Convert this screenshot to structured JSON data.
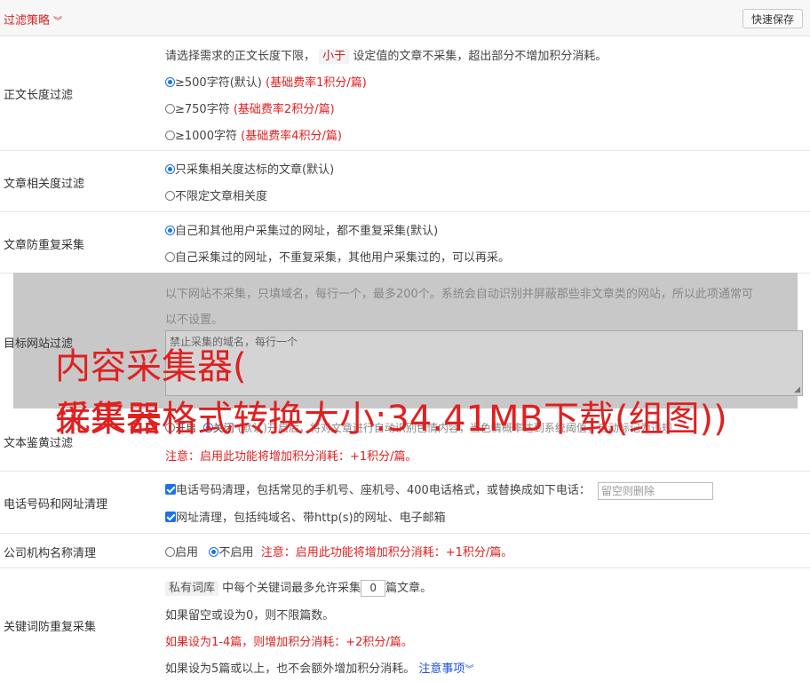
{
  "header": {
    "title": "过滤策略",
    "save_label": "快速保存"
  },
  "length_filter": {
    "label": "正文长度过滤",
    "desc_before": "请选择需求的正文长度下限，",
    "desc_pill": "小于",
    "desc_after": "设定值的文章不采集，超出部分不增加积分消耗。",
    "options": [
      {
        "text": "≥500字符(默认)",
        "note": "(基础费率1积分/篇)",
        "selected": true
      },
      {
        "text": "≥750字符",
        "note": "(基础费率2积分/篇)",
        "selected": false
      },
      {
        "text": "≥1000字符",
        "note": "(基础费率4积分/篇)",
        "selected": false
      }
    ]
  },
  "relevance_filter": {
    "label": "文章相关度过滤",
    "options": [
      {
        "text": "只采集相关度达标的文章(默认)",
        "selected": true
      },
      {
        "text": "不限定文章相关度",
        "selected": false
      }
    ]
  },
  "dedupe": {
    "label": "文章防重复采集",
    "options": [
      {
        "text": "自己和其他用户采集过的网址，都不重复采集(默认)",
        "selected": true
      },
      {
        "text": "自己采集过的网址，不重复采集，其他用户采集过的，可以再采。",
        "selected": false
      }
    ]
  },
  "site_filter": {
    "label": "目标网站过滤",
    "desc_line1": "以下网站不采集，只填域名，每行一个，最多200个。系统会自动识别并屏蔽那些非文章类的网站，所以此项通常可",
    "desc_line2": "以不设置。",
    "placeholder": "禁止采集的域名，每行一个"
  },
  "watermark": {
    "line1": "内容采集器(",
    "line2": "优采云",
    "line3": "采集器格式转换大小:34.41MB下载(组图))"
  },
  "porn_filter": {
    "label": "文本鉴黄过滤",
    "opt_on": "开启",
    "opt_off": "关闭",
    "desc": "(默认)开启后，将对文章进行自动识别色情内容，当色情概率达到系统阈值，自动标记为违规",
    "note": "注意：启用此功能将增加积分消耗：+1积分/篇。"
  },
  "phone_url_clean": {
    "label": "电话号码和网址清理",
    "phone_text": "电话号码清理，包括常见的手机号、座机号、400电话格式，或替换成如下电话：",
    "phone_placeholder": "留空则删除",
    "url_text": "网址清理，包括纯域名、带http(s)的网址、电子邮箱"
  },
  "company_clean": {
    "label": "公司机构名称清理",
    "opt_on": "启用",
    "opt_off": "不启用",
    "note": "注意：启用此功能将增加积分消耗：+1积分/篇。"
  },
  "keyword_dedupe": {
    "label": "关键词防重复采集",
    "pill": "私有词库",
    "text_before": "中每个关键词最多允许采集",
    "count": "0",
    "text_after": "篇文章。",
    "line2": "如果留空或设为0，则不限篇数。",
    "line3": "如果设为1-4篇，则增加积分消耗：+2积分/篇。",
    "line4": "如果设为5篇或以上，也不会额外增加积分消耗。",
    "notice_link": "注意事项"
  },
  "colors": {
    "accent": "#e02020",
    "link": "#1a4fd8",
    "radio": "#1a73e8"
  }
}
